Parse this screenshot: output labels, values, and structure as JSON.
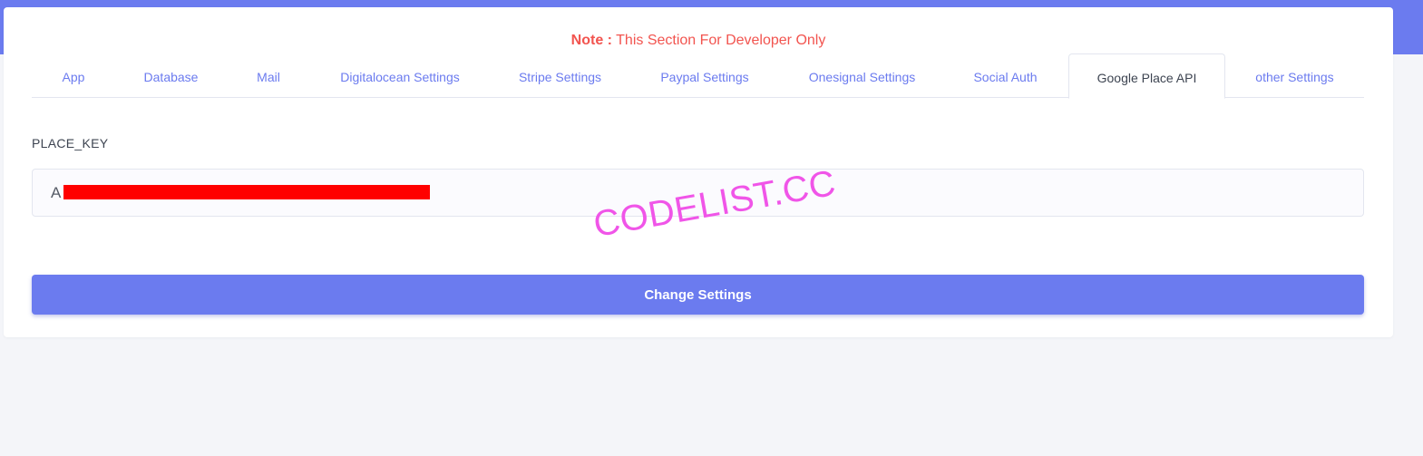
{
  "notice": {
    "label": "Note :",
    "text": " This Section For Developer Only",
    "color": "#f2544f"
  },
  "tabs": [
    {
      "label": "App",
      "active": false
    },
    {
      "label": "Database",
      "active": false
    },
    {
      "label": "Mail",
      "active": false
    },
    {
      "label": "Digitalocean Settings",
      "active": false
    },
    {
      "label": "Stripe Settings",
      "active": false
    },
    {
      "label": "Paypal Settings",
      "active": false
    },
    {
      "label": "Onesignal Settings",
      "active": false
    },
    {
      "label": "Social Auth",
      "active": false
    },
    {
      "label": "Google Place API",
      "active": true
    },
    {
      "label": "other Settings",
      "active": false
    }
  ],
  "form": {
    "place_key_label": "PLACE_KEY",
    "place_key_value": "A"
  },
  "watermark": "CODELIST.CC",
  "actions": {
    "submit_label": "Change Settings"
  },
  "colors": {
    "accent": "#6b7bef",
    "background": "#f4f5f9",
    "redaction": "#ff0000",
    "watermark": "#f055e8"
  }
}
